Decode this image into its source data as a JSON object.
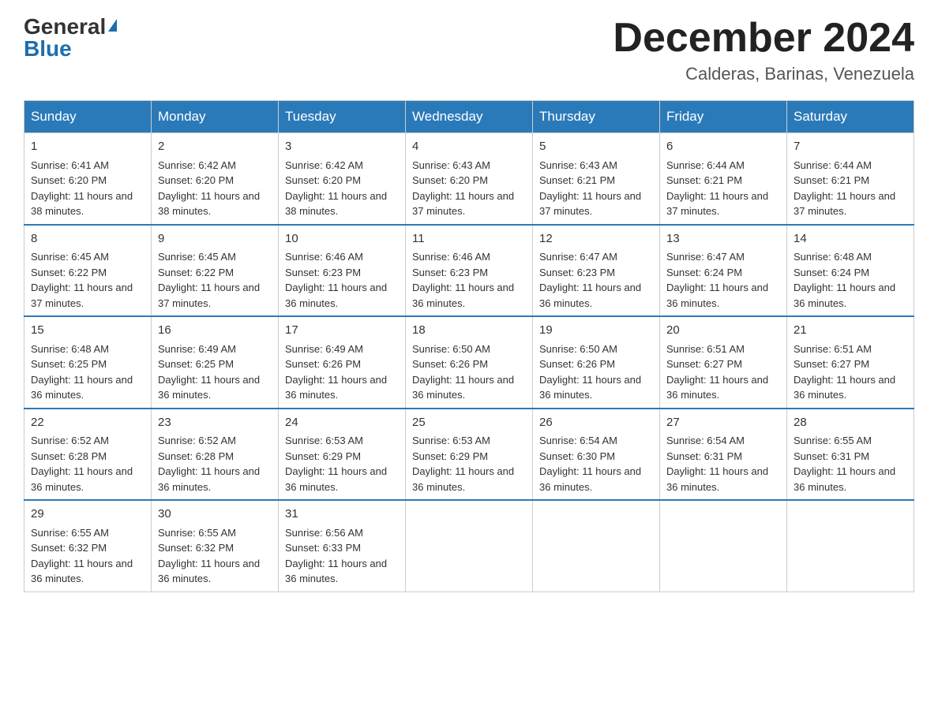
{
  "header": {
    "logo_general": "General",
    "logo_blue": "Blue",
    "month_title": "December 2024",
    "location": "Calderas, Barinas, Venezuela"
  },
  "weekdays": [
    "Sunday",
    "Monday",
    "Tuesday",
    "Wednesday",
    "Thursday",
    "Friday",
    "Saturday"
  ],
  "weeks": [
    [
      {
        "day": "1",
        "sunrise": "6:41 AM",
        "sunset": "6:20 PM",
        "daylight": "11 hours and 38 minutes."
      },
      {
        "day": "2",
        "sunrise": "6:42 AM",
        "sunset": "6:20 PM",
        "daylight": "11 hours and 38 minutes."
      },
      {
        "day": "3",
        "sunrise": "6:42 AM",
        "sunset": "6:20 PM",
        "daylight": "11 hours and 38 minutes."
      },
      {
        "day": "4",
        "sunrise": "6:43 AM",
        "sunset": "6:20 PM",
        "daylight": "11 hours and 37 minutes."
      },
      {
        "day": "5",
        "sunrise": "6:43 AM",
        "sunset": "6:21 PM",
        "daylight": "11 hours and 37 minutes."
      },
      {
        "day": "6",
        "sunrise": "6:44 AM",
        "sunset": "6:21 PM",
        "daylight": "11 hours and 37 minutes."
      },
      {
        "day": "7",
        "sunrise": "6:44 AM",
        "sunset": "6:21 PM",
        "daylight": "11 hours and 37 minutes."
      }
    ],
    [
      {
        "day": "8",
        "sunrise": "6:45 AM",
        "sunset": "6:22 PM",
        "daylight": "11 hours and 37 minutes."
      },
      {
        "day": "9",
        "sunrise": "6:45 AM",
        "sunset": "6:22 PM",
        "daylight": "11 hours and 37 minutes."
      },
      {
        "day": "10",
        "sunrise": "6:46 AM",
        "sunset": "6:23 PM",
        "daylight": "11 hours and 36 minutes."
      },
      {
        "day": "11",
        "sunrise": "6:46 AM",
        "sunset": "6:23 PM",
        "daylight": "11 hours and 36 minutes."
      },
      {
        "day": "12",
        "sunrise": "6:47 AM",
        "sunset": "6:23 PM",
        "daylight": "11 hours and 36 minutes."
      },
      {
        "day": "13",
        "sunrise": "6:47 AM",
        "sunset": "6:24 PM",
        "daylight": "11 hours and 36 minutes."
      },
      {
        "day": "14",
        "sunrise": "6:48 AM",
        "sunset": "6:24 PM",
        "daylight": "11 hours and 36 minutes."
      }
    ],
    [
      {
        "day": "15",
        "sunrise": "6:48 AM",
        "sunset": "6:25 PM",
        "daylight": "11 hours and 36 minutes."
      },
      {
        "day": "16",
        "sunrise": "6:49 AM",
        "sunset": "6:25 PM",
        "daylight": "11 hours and 36 minutes."
      },
      {
        "day": "17",
        "sunrise": "6:49 AM",
        "sunset": "6:26 PM",
        "daylight": "11 hours and 36 minutes."
      },
      {
        "day": "18",
        "sunrise": "6:50 AM",
        "sunset": "6:26 PM",
        "daylight": "11 hours and 36 minutes."
      },
      {
        "day": "19",
        "sunrise": "6:50 AM",
        "sunset": "6:26 PM",
        "daylight": "11 hours and 36 minutes."
      },
      {
        "day": "20",
        "sunrise": "6:51 AM",
        "sunset": "6:27 PM",
        "daylight": "11 hours and 36 minutes."
      },
      {
        "day": "21",
        "sunrise": "6:51 AM",
        "sunset": "6:27 PM",
        "daylight": "11 hours and 36 minutes."
      }
    ],
    [
      {
        "day": "22",
        "sunrise": "6:52 AM",
        "sunset": "6:28 PM",
        "daylight": "11 hours and 36 minutes."
      },
      {
        "day": "23",
        "sunrise": "6:52 AM",
        "sunset": "6:28 PM",
        "daylight": "11 hours and 36 minutes."
      },
      {
        "day": "24",
        "sunrise": "6:53 AM",
        "sunset": "6:29 PM",
        "daylight": "11 hours and 36 minutes."
      },
      {
        "day": "25",
        "sunrise": "6:53 AM",
        "sunset": "6:29 PM",
        "daylight": "11 hours and 36 minutes."
      },
      {
        "day": "26",
        "sunrise": "6:54 AM",
        "sunset": "6:30 PM",
        "daylight": "11 hours and 36 minutes."
      },
      {
        "day": "27",
        "sunrise": "6:54 AM",
        "sunset": "6:31 PM",
        "daylight": "11 hours and 36 minutes."
      },
      {
        "day": "28",
        "sunrise": "6:55 AM",
        "sunset": "6:31 PM",
        "daylight": "11 hours and 36 minutes."
      }
    ],
    [
      {
        "day": "29",
        "sunrise": "6:55 AM",
        "sunset": "6:32 PM",
        "daylight": "11 hours and 36 minutes."
      },
      {
        "day": "30",
        "sunrise": "6:55 AM",
        "sunset": "6:32 PM",
        "daylight": "11 hours and 36 minutes."
      },
      {
        "day": "31",
        "sunrise": "6:56 AM",
        "sunset": "6:33 PM",
        "daylight": "11 hours and 36 minutes."
      },
      null,
      null,
      null,
      null
    ]
  ],
  "labels": {
    "sunrise": "Sunrise:",
    "sunset": "Sunset:",
    "daylight": "Daylight:"
  }
}
